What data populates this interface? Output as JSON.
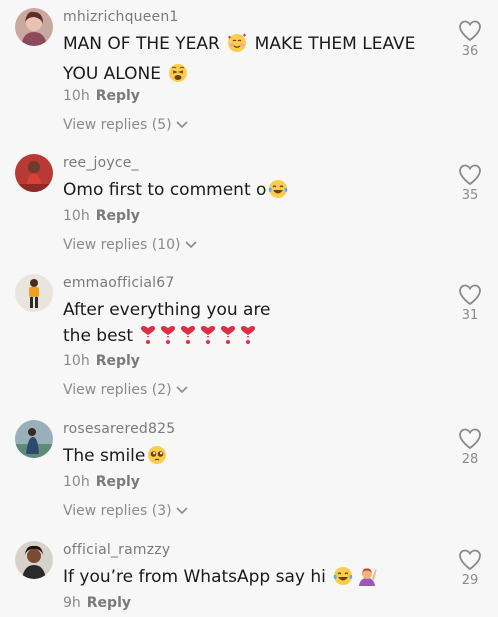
{
  "comments": [
    {
      "username": "mhizrichqueen1",
      "text_parts": [
        "MAN OF THE YEAR ",
        " MAKE THEM LEAVE YOU ALONE "
      ],
      "emojis": [
        "smiling-face-with-hearts",
        "weary-face"
      ],
      "time": "10h",
      "reply_label": "Reply",
      "view_replies": "View replies (5)",
      "likes": "36"
    },
    {
      "username": "ree_joyce_",
      "text_parts": [
        "Omo first to comment o"
      ],
      "emojis": [
        "tears-of-joy"
      ],
      "time": "10h",
      "reply_label": "Reply",
      "view_replies": "View replies (10)",
      "likes": "35"
    },
    {
      "username": "emmaofficial67",
      "text_parts": [
        "After everything you are the best "
      ],
      "emojis": [
        "heart-exclamation",
        "heart-exclamation",
        "heart-exclamation",
        "heart-exclamation",
        "heart-exclamation",
        "heart-exclamation"
      ],
      "time": "10h",
      "reply_label": "Reply",
      "view_replies": "View replies (2)",
      "likes": "31"
    },
    {
      "username": "rosesarered825",
      "text_parts": [
        "The smile"
      ],
      "emojis": [
        "pleading-face"
      ],
      "time": "10h",
      "reply_label": "Reply",
      "view_replies": "View replies (3)",
      "likes": "28"
    },
    {
      "username": "official_ramzzy",
      "text_parts": [
        "If you’re from WhatsApp say hi "
      ],
      "emojis": [
        "tears-of-joy",
        "person-raising-hand"
      ],
      "time": "9h",
      "reply_label": "Reply",
      "likes": "29"
    }
  ],
  "icons": {
    "like": "heart-outline-icon",
    "chevron": "chevron-down-icon"
  },
  "colors": {
    "background": "#f7f7f7",
    "username": "#7a7a7a",
    "text": "#1a1a1a",
    "meta": "#8a8a8a"
  }
}
